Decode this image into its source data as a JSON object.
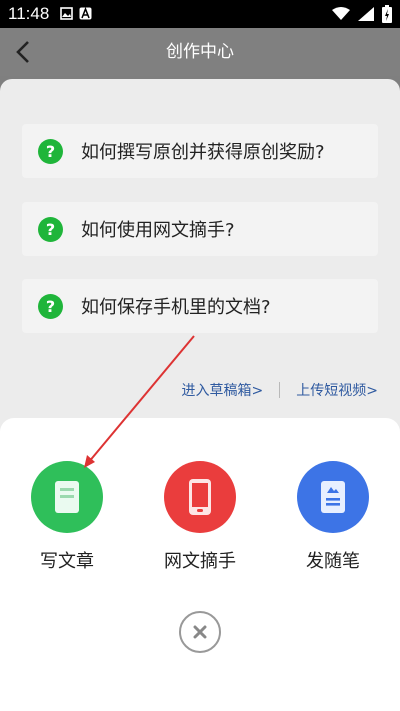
{
  "status_bar": {
    "time": "11:48"
  },
  "header": {
    "title": "创作中心"
  },
  "faq": {
    "items": [
      {
        "label": "如何撰写原创并获得原创奖励?"
      },
      {
        "label": "如何使用网文摘手?"
      },
      {
        "label": "如何保存手机里的文档?"
      }
    ]
  },
  "links": {
    "drafts": "进入草稿箱>",
    "upload_video": "上传短视频>"
  },
  "actions": [
    {
      "label": "写文章",
      "icon": "document-icon",
      "color": "#2fbf5a"
    },
    {
      "label": "网文摘手",
      "icon": "phone-icon",
      "color": "#ea3d3d"
    },
    {
      "label": "发随笔",
      "icon": "note-icon",
      "color": "#3d74e6"
    }
  ],
  "colors": {
    "accent_green": "#1fb53a",
    "link_blue": "#2f5aa0",
    "arrow_red": "#d33"
  }
}
